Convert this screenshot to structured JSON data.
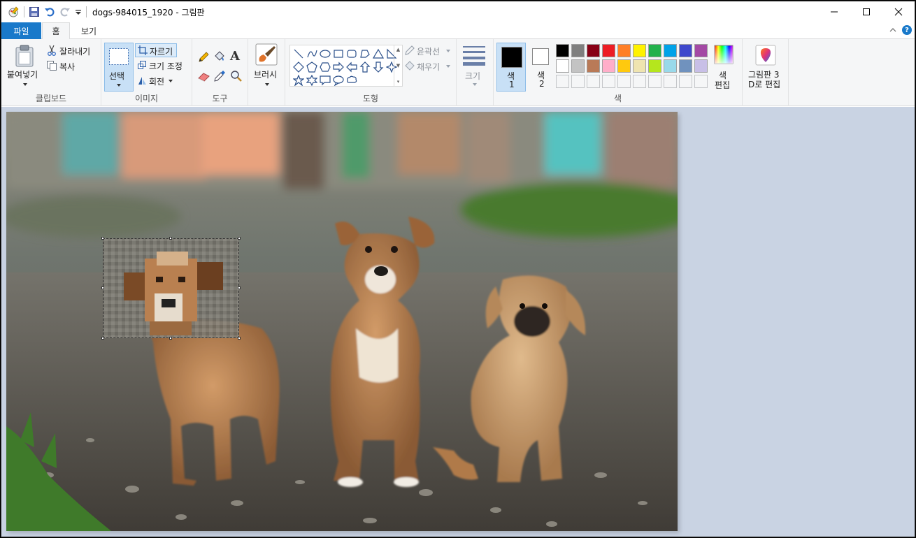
{
  "window": {
    "title": "dogs-984015_1920 - 그림판"
  },
  "tabs": {
    "file": "파일",
    "home": "홈",
    "view": "보기"
  },
  "clipboard": {
    "paste": "붙여넣기",
    "cut": "잘라내기",
    "copy": "복사",
    "label": "클립보드"
  },
  "image": {
    "select": "선택",
    "crop": "자르기",
    "resize": "크기 조정",
    "rotate": "회전",
    "label": "이미지"
  },
  "tools": {
    "text_glyph": "A",
    "label": "도구"
  },
  "brushes": {
    "label": "브러시"
  },
  "shapes": {
    "outline": "윤곽선",
    "fill": "채우기",
    "label": "도형"
  },
  "size": {
    "label": "크기"
  },
  "colors": {
    "color1_label": "색\n1",
    "color1_a": "색",
    "color1_b": "1",
    "color2_a": "색",
    "color2_b": "2",
    "edit_a": "색",
    "edit_b": "편집",
    "label": "색",
    "color1": "#000000",
    "color2": "#ffffff",
    "palette": [
      "#000000",
      "#7f7f7f",
      "#880015",
      "#ed1c24",
      "#ff7f27",
      "#fff200",
      "#22b14c",
      "#00a2e8",
      "#3f48cc",
      "#a349a4",
      "#ffffff",
      "#c3c3c3",
      "#b97a57",
      "#ffaec9",
      "#ffc90e",
      "#efe4b0",
      "#b5e61d",
      "#99d9ea",
      "#7092be",
      "#c8bfe7",
      "#f5f6f7",
      "#f5f6f7",
      "#f5f6f7",
      "#f5f6f7",
      "#f5f6f7",
      "#f5f6f7",
      "#f5f6f7",
      "#f5f6f7",
      "#f5f6f7",
      "#f5f6f7"
    ]
  },
  "paint3d": {
    "line1": "그림판 3",
    "line2": "D로 편집"
  }
}
